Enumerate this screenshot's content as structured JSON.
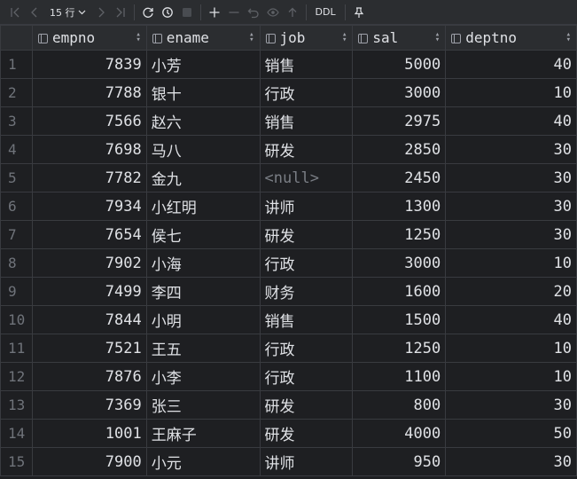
{
  "toolbar": {
    "rows_label": "15 行",
    "ddl_label": "DDL"
  },
  "columns": [
    {
      "name": "empno"
    },
    {
      "name": "ename"
    },
    {
      "name": "job"
    },
    {
      "name": "sal"
    },
    {
      "name": "deptno"
    }
  ],
  "rows": [
    {
      "n": "1",
      "empno": "7839",
      "ename": "小芳",
      "job": "销售",
      "sal": "5000",
      "deptno": "40"
    },
    {
      "n": "2",
      "empno": "7788",
      "ename": "银十",
      "job": "行政",
      "sal": "3000",
      "deptno": "10"
    },
    {
      "n": "3",
      "empno": "7566",
      "ename": "赵六",
      "job": "销售",
      "sal": "2975",
      "deptno": "40"
    },
    {
      "n": "4",
      "empno": "7698",
      "ename": "马八",
      "job": "研发",
      "sal": "2850",
      "deptno": "30"
    },
    {
      "n": "5",
      "empno": "7782",
      "ename": "金九",
      "job": "<null>",
      "sal": "2450",
      "deptno": "30"
    },
    {
      "n": "6",
      "empno": "7934",
      "ename": "小红明",
      "job": "讲师",
      "sal": "1300",
      "deptno": "30"
    },
    {
      "n": "7",
      "empno": "7654",
      "ename": "侯七",
      "job": "研发",
      "sal": "1250",
      "deptno": "30"
    },
    {
      "n": "8",
      "empno": "7902",
      "ename": "小海",
      "job": "行政",
      "sal": "3000",
      "deptno": "10"
    },
    {
      "n": "9",
      "empno": "7499",
      "ename": "李四",
      "job": "财务",
      "sal": "1600",
      "deptno": "20"
    },
    {
      "n": "10",
      "empno": "7844",
      "ename": "小明",
      "job": "销售",
      "sal": "1500",
      "deptno": "40"
    },
    {
      "n": "11",
      "empno": "7521",
      "ename": "王五",
      "job": "行政",
      "sal": "1250",
      "deptno": "10"
    },
    {
      "n": "12",
      "empno": "7876",
      "ename": "小李",
      "job": "行政",
      "sal": "1100",
      "deptno": "10"
    },
    {
      "n": "13",
      "empno": "7369",
      "ename": "张三",
      "job": "研发",
      "sal": "800",
      "deptno": "30"
    },
    {
      "n": "14",
      "empno": "1001",
      "ename": "王麻子",
      "job": "研发",
      "sal": "4000",
      "deptno": "50"
    },
    {
      "n": "15",
      "empno": "7900",
      "ename": "小元",
      "job": "讲师",
      "sal": "950",
      "deptno": "30"
    }
  ]
}
